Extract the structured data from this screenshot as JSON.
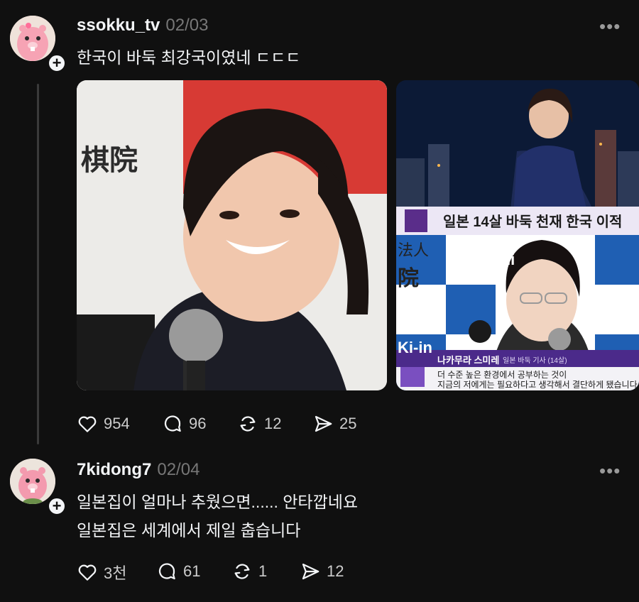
{
  "post": {
    "username": "ssokku_tv",
    "date": "02/03",
    "text": "한국이 바둑 최강국이였네 ㄷㄷㄷ",
    "more": "•••",
    "images": [
      {
        "name": "photo-girl-smiling",
        "visible_text": "棋院"
      },
      {
        "name": "news-capture",
        "caption_top": "일본 14살 바둑 천재 한국 이적",
        "sign": "The Ni",
        "sign2": "Ki-in",
        "bg_text": "法人",
        "bg_text2": "院",
        "person": "나카무라 스미레",
        "person_title": "일본 바둑 기사 (14살)",
        "quote1": "더 수준 높은 환경에서 공부하는 것이",
        "quote2": "지금의 저에게는 필요하다고 생각해서 결단하게 됐습니다."
      }
    ],
    "stats": {
      "likes": "954",
      "replies": "96",
      "reposts": "12",
      "shares": "25"
    }
  },
  "reply": {
    "username": "7kidong7",
    "date": "02/04",
    "line1": "일본집이 얼마나 추웠으면...... 안타깝네요",
    "line2": "일본집은 세계에서 제일 춥습니다",
    "more": "•••",
    "stats": {
      "likes": "3천",
      "replies": "61",
      "reposts": "1",
      "shares": "12"
    }
  },
  "colors": {
    "background": "#101010",
    "text": "#f3f5f7",
    "muted": "#777777",
    "thread_line": "#3a3a3a"
  }
}
